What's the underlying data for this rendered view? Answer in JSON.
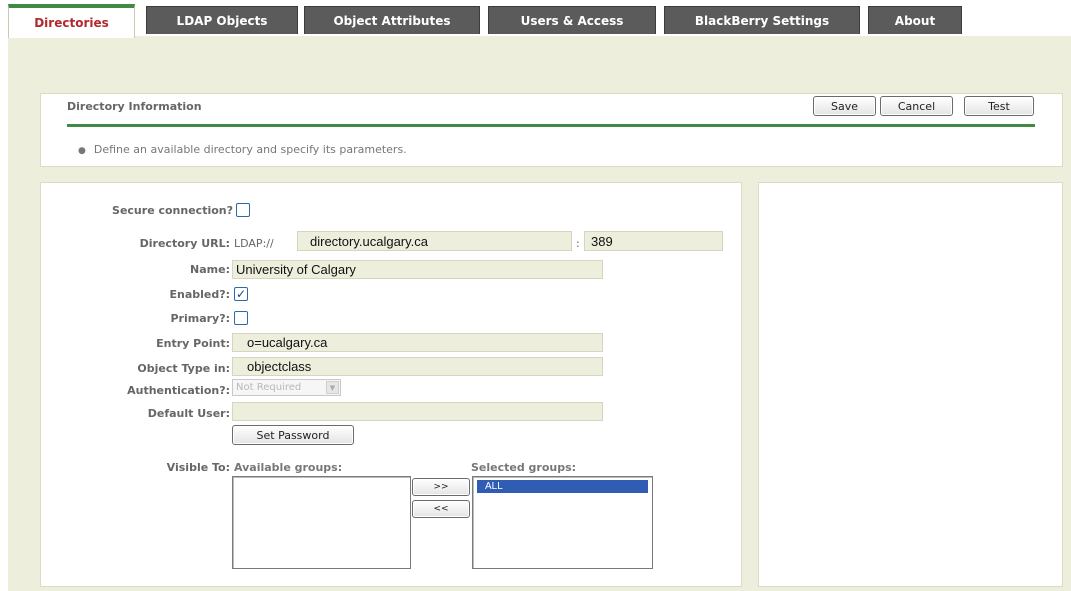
{
  "tabs": [
    {
      "label": "Directories",
      "active": true
    },
    {
      "label": "LDAP Objects",
      "active": false
    },
    {
      "label": "Object Attributes",
      "active": false
    },
    {
      "label": "Users & Access",
      "active": false
    },
    {
      "label": "BlackBerry Settings",
      "active": false
    },
    {
      "label": "About",
      "active": false
    }
  ],
  "header": {
    "title": "Directory Information",
    "hint": "Define an available directory and specify its parameters.",
    "buttons": {
      "save": "Save",
      "cancel": "Cancel",
      "test": "Test"
    }
  },
  "form": {
    "secure_label": "Secure connection?",
    "secure_checked": false,
    "url_label": "Directory URL:",
    "url_prefix": "LDAP://",
    "url_host": "directory.ucalgary.ca",
    "url_sep": ":",
    "url_port": "389",
    "name_label": "Name:",
    "name_value": "University of Calgary",
    "enabled_label": "Enabled?:",
    "enabled_checked": true,
    "primary_label": "Primary?:",
    "primary_checked": false,
    "entry_label": "Entry Point:",
    "entry_value": "o=ucalgary.ca",
    "objtype_label": "Object Type in:",
    "objtype_value": "objectclass",
    "auth_label": "Authentication?:",
    "auth_value": "Not Required",
    "default_user_label": "Default User:",
    "default_user_value": "",
    "set_password": "Set Password",
    "visible_label": "Visible To:",
    "available_label": "Available groups:",
    "selected_label": "Selected groups:",
    "add_btn": ">>",
    "remove_btn": "<<",
    "available_groups": [],
    "selected_groups": [
      "ALL"
    ],
    "check_mark": "✓"
  },
  "colors": {
    "accent_green": "#3f8a45",
    "active_tab_text": "#b3282d",
    "tab_bg": "#5b5b5b",
    "page_bg": "#eeeedd",
    "selected_option": "#2f5db3"
  }
}
